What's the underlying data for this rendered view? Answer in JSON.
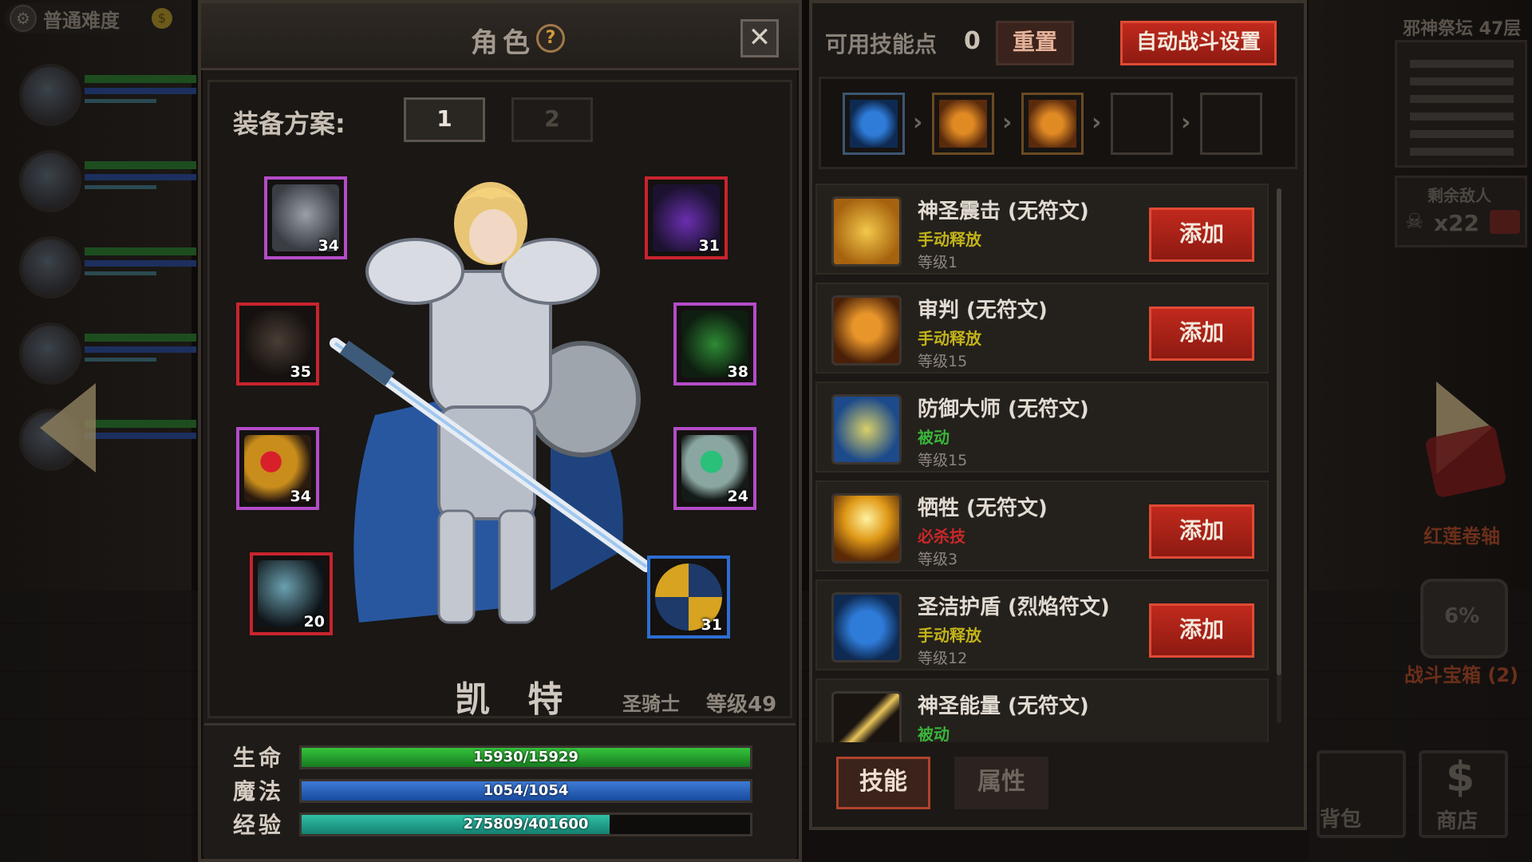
{
  "background": {
    "difficulty": "普通难度",
    "floor": "邪神祭坛 47层",
    "enemies_label": "剩余敌人",
    "enemies_count": "x22",
    "scroll_label": "红莲卷轴",
    "chest_percent": "6%",
    "chest_label": "战斗宝箱 (2)",
    "bag_label": "背包",
    "shop_label": "商店",
    "currency_symbol": "$"
  },
  "character": {
    "title": "角色",
    "help": "?",
    "close": "✕",
    "loadout_label": "装备方案:",
    "loadouts": [
      "1",
      "2"
    ],
    "name": "凯 特",
    "class": "圣骑士",
    "level": "等级49",
    "equipment": [
      {
        "slot": "helmet",
        "level": "34",
        "rarity": "purple"
      },
      {
        "slot": "cape",
        "level": "31",
        "rarity": "red"
      },
      {
        "slot": "armor",
        "level": "35",
        "rarity": "red"
      },
      {
        "slot": "boots",
        "level": "38",
        "rarity": "purple"
      },
      {
        "slot": "ring-ruby",
        "level": "34",
        "rarity": "purple"
      },
      {
        "slot": "ring-emerald",
        "level": "24",
        "rarity": "purple"
      },
      {
        "slot": "axe",
        "level": "20",
        "rarity": "red"
      },
      {
        "slot": "shield",
        "level": "31",
        "rarity": "blue"
      }
    ],
    "stats": {
      "hp_label": "生命",
      "hp_text": "15930/15929",
      "hp_fill": 1.0,
      "mp_label": "魔法",
      "mp_text": "1054/1054",
      "mp_fill": 1.0,
      "xp_label": "经验",
      "xp_text": "275809/401600",
      "xp_fill": 0.687
    }
  },
  "skills": {
    "points_label": "可用技能点",
    "points_value": "0",
    "reset_label": "重置",
    "auto_battle_label": "自动战斗设置",
    "chain_icons": [
      "shield-skill-icon",
      "hammer-skill-icon",
      "hammer-skill-icon",
      "empty",
      "empty"
    ],
    "list": [
      {
        "name": "神圣震击 (无符文)",
        "type": "手动释放",
        "type_color": "#c2b31a",
        "level": "等级1",
        "icon": "holy-hand-icon",
        "button": "添加"
      },
      {
        "name": "审判 (无符文)",
        "type": "手动释放",
        "type_color": "#c2b31a",
        "level": "等级15",
        "icon": "hammer-icon",
        "button": "添加"
      },
      {
        "name": "防御大师 (无符文)",
        "type": "被动",
        "type_color": "#3ab53a",
        "level": "等级15",
        "icon": "knight-defense-icon",
        "button": ""
      },
      {
        "name": "牺牲 (无符文)",
        "type": "必杀技",
        "type_color": "#c8282a",
        "level": "等级3",
        "icon": "sacrifice-icon",
        "button": "添加"
      },
      {
        "name": "圣洁护盾 (烈焰符文)",
        "type": "手动释放",
        "type_color": "#c2b31a",
        "level": "等级12",
        "icon": "holy-shield-icon",
        "button": "添加"
      },
      {
        "name": "神圣能量 (无符文)",
        "type": "被动",
        "type_color": "#3ab53a",
        "level": "",
        "icon": "holy-energy-icon",
        "button": ""
      }
    ],
    "tabs": [
      "技能",
      "属性"
    ]
  }
}
